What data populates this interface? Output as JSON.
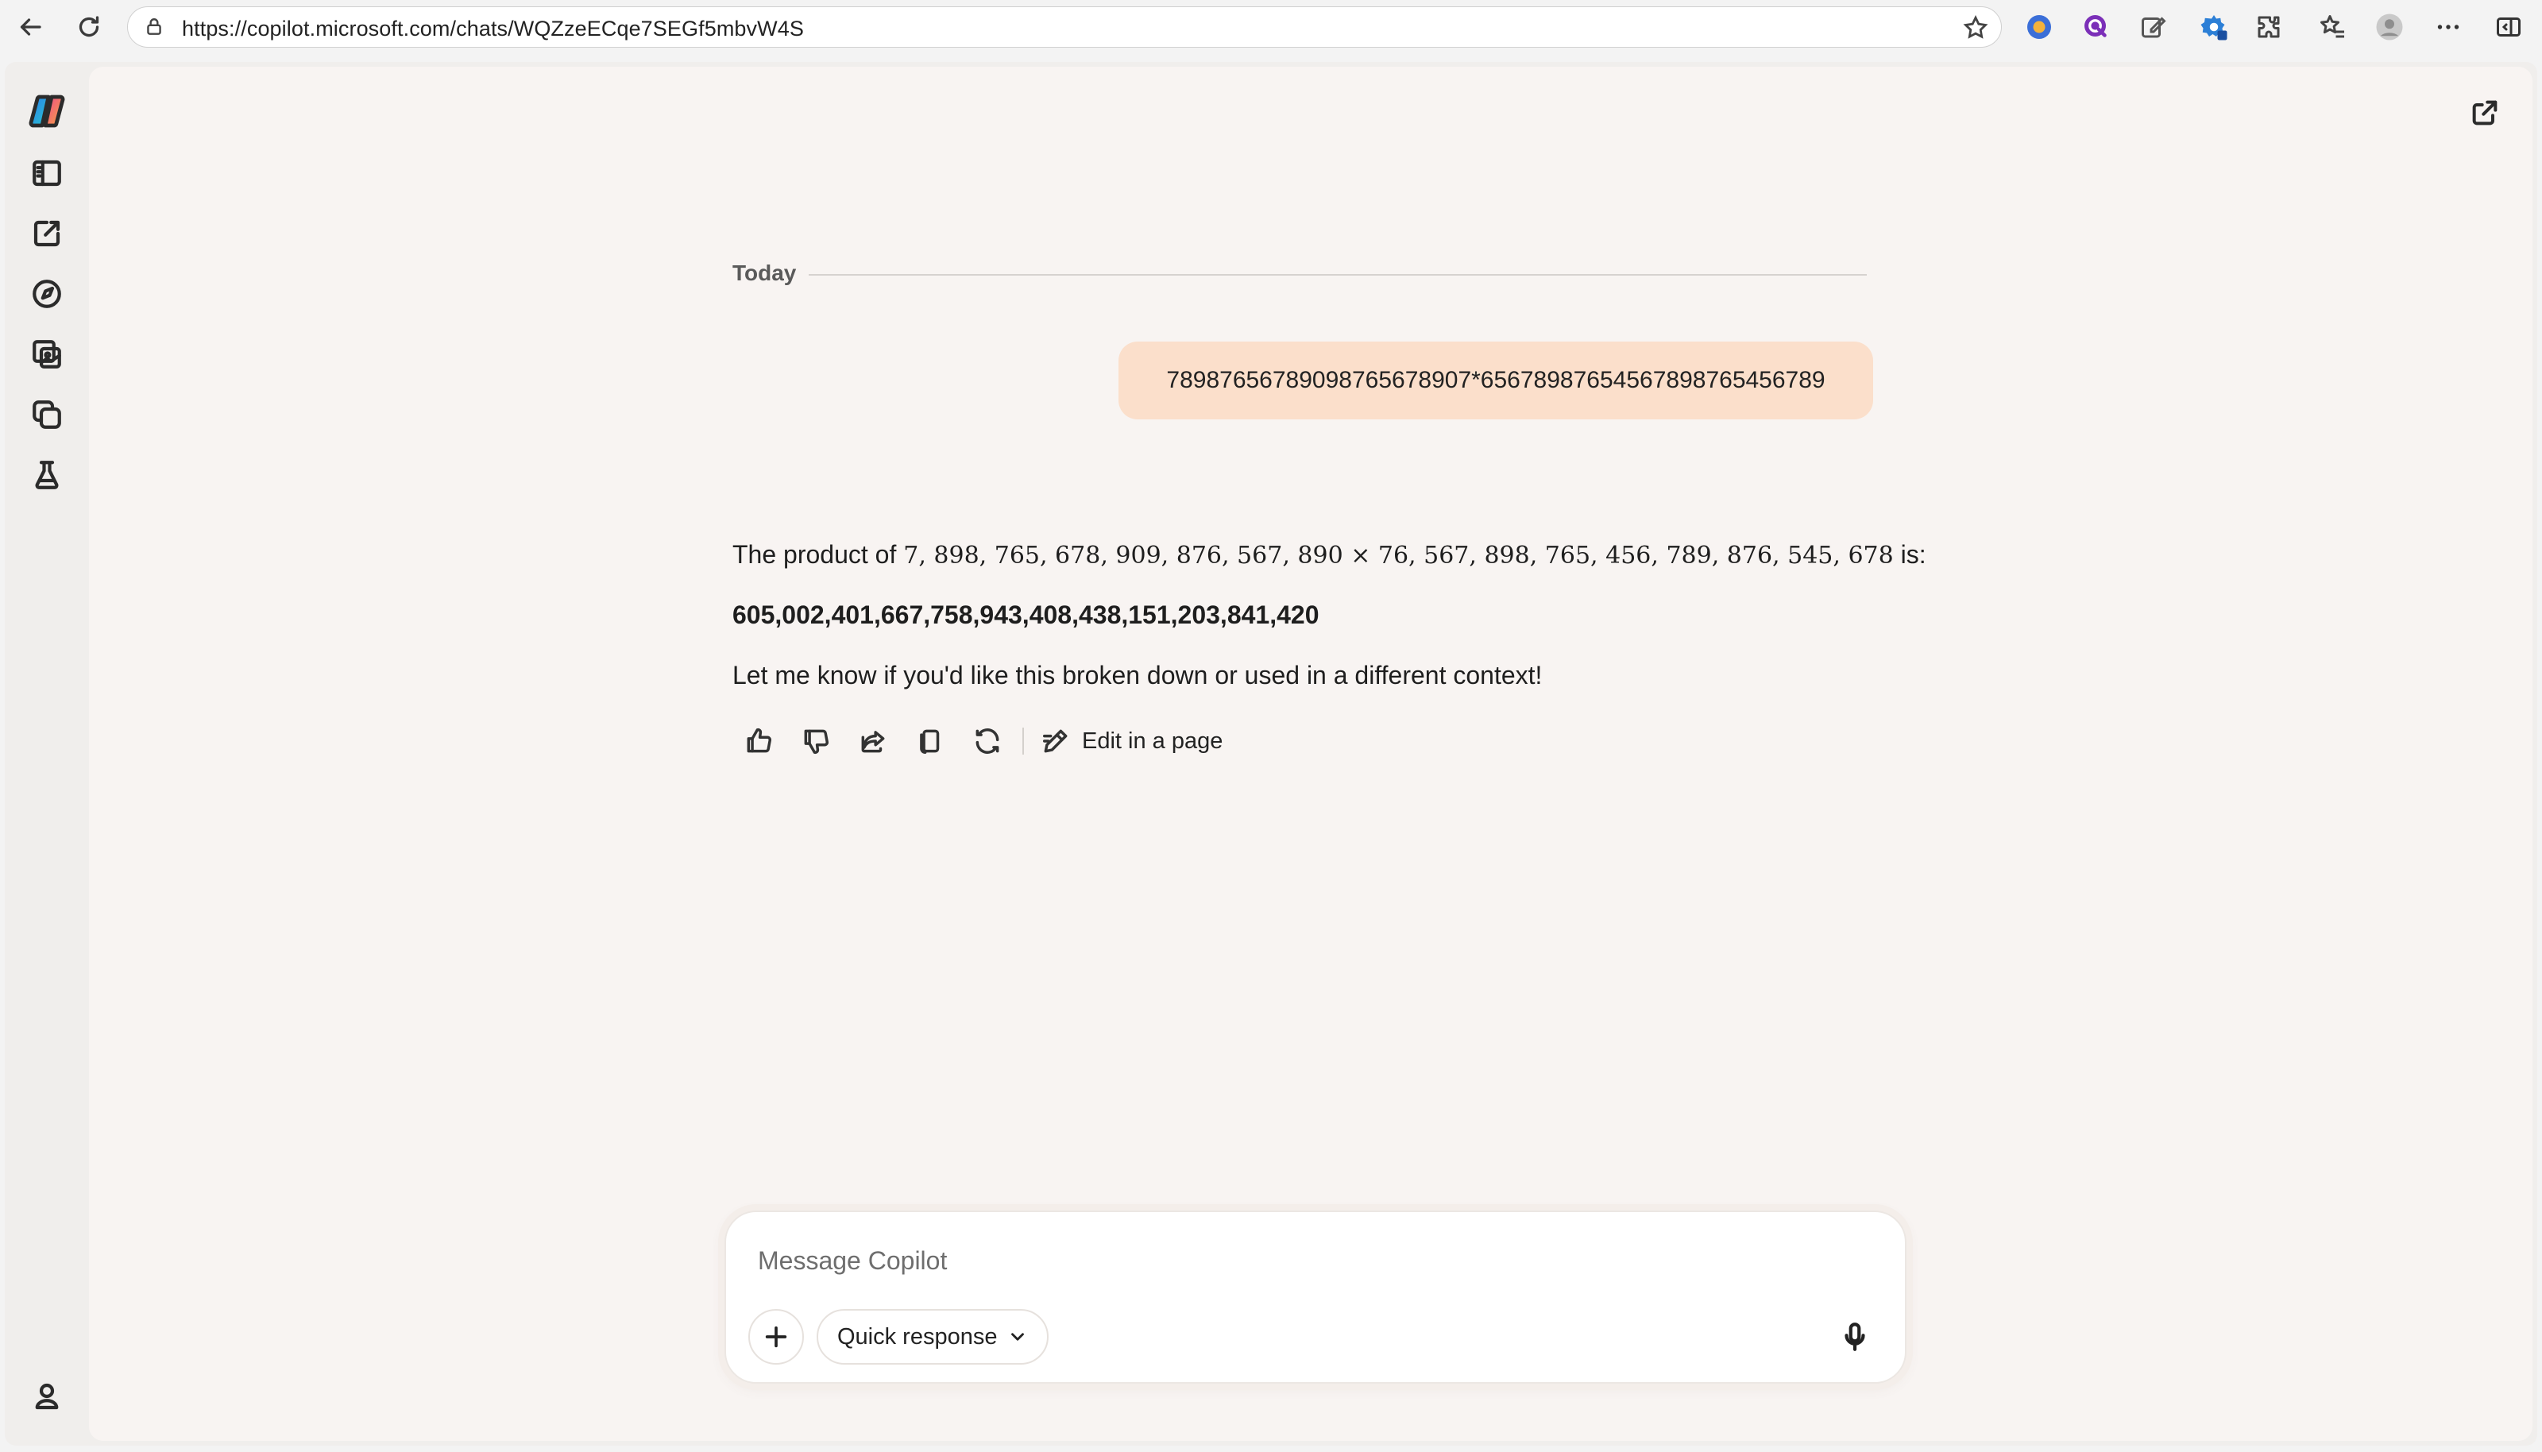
{
  "browser": {
    "url": "https://copilot.microsoft.com/chats/WQZzeECqe7SEGf5mbvW4S",
    "icons": [
      "back-arrow-icon",
      "refresh-icon",
      "lock-icon",
      "favorite-star-icon",
      "extension-icons",
      "puzzle-icon",
      "favorites-icon",
      "profile-icon",
      "more-icon",
      "sidebar-toggle-icon"
    ]
  },
  "rail": {
    "icons": [
      "copilot-logo",
      "sidebar-panel-icon",
      "new-chat-icon",
      "discover-icon",
      "image-gallery-icon",
      "pages-icon",
      "labs-flask-icon",
      "account-icon"
    ]
  },
  "conversation": {
    "day_label": "Today",
    "user_message": "78987656789098765678907*65678987654567898765456789",
    "answer": {
      "intro": "The product of",
      "math_expression": "7, 898, 765, 678, 909, 876, 567, 890 × 76, 567, 898, 765, 456, 789, 876, 545, 678",
      "intro_suffix": "is:",
      "result": "605,002,401,667,758,943,408,438,151,203,841,420",
      "followup": "Let me know if you'd like this broken down or used in a different context!"
    },
    "actions": {
      "edit_in_page_label": "Edit in a page"
    }
  },
  "composer": {
    "placeholder": "Message Copilot",
    "mode_label": "Quick response"
  },
  "colors": {
    "user_bubble": "#fbdfcb",
    "canvas": "#f8f4f2",
    "frame": "#f0eeec"
  }
}
